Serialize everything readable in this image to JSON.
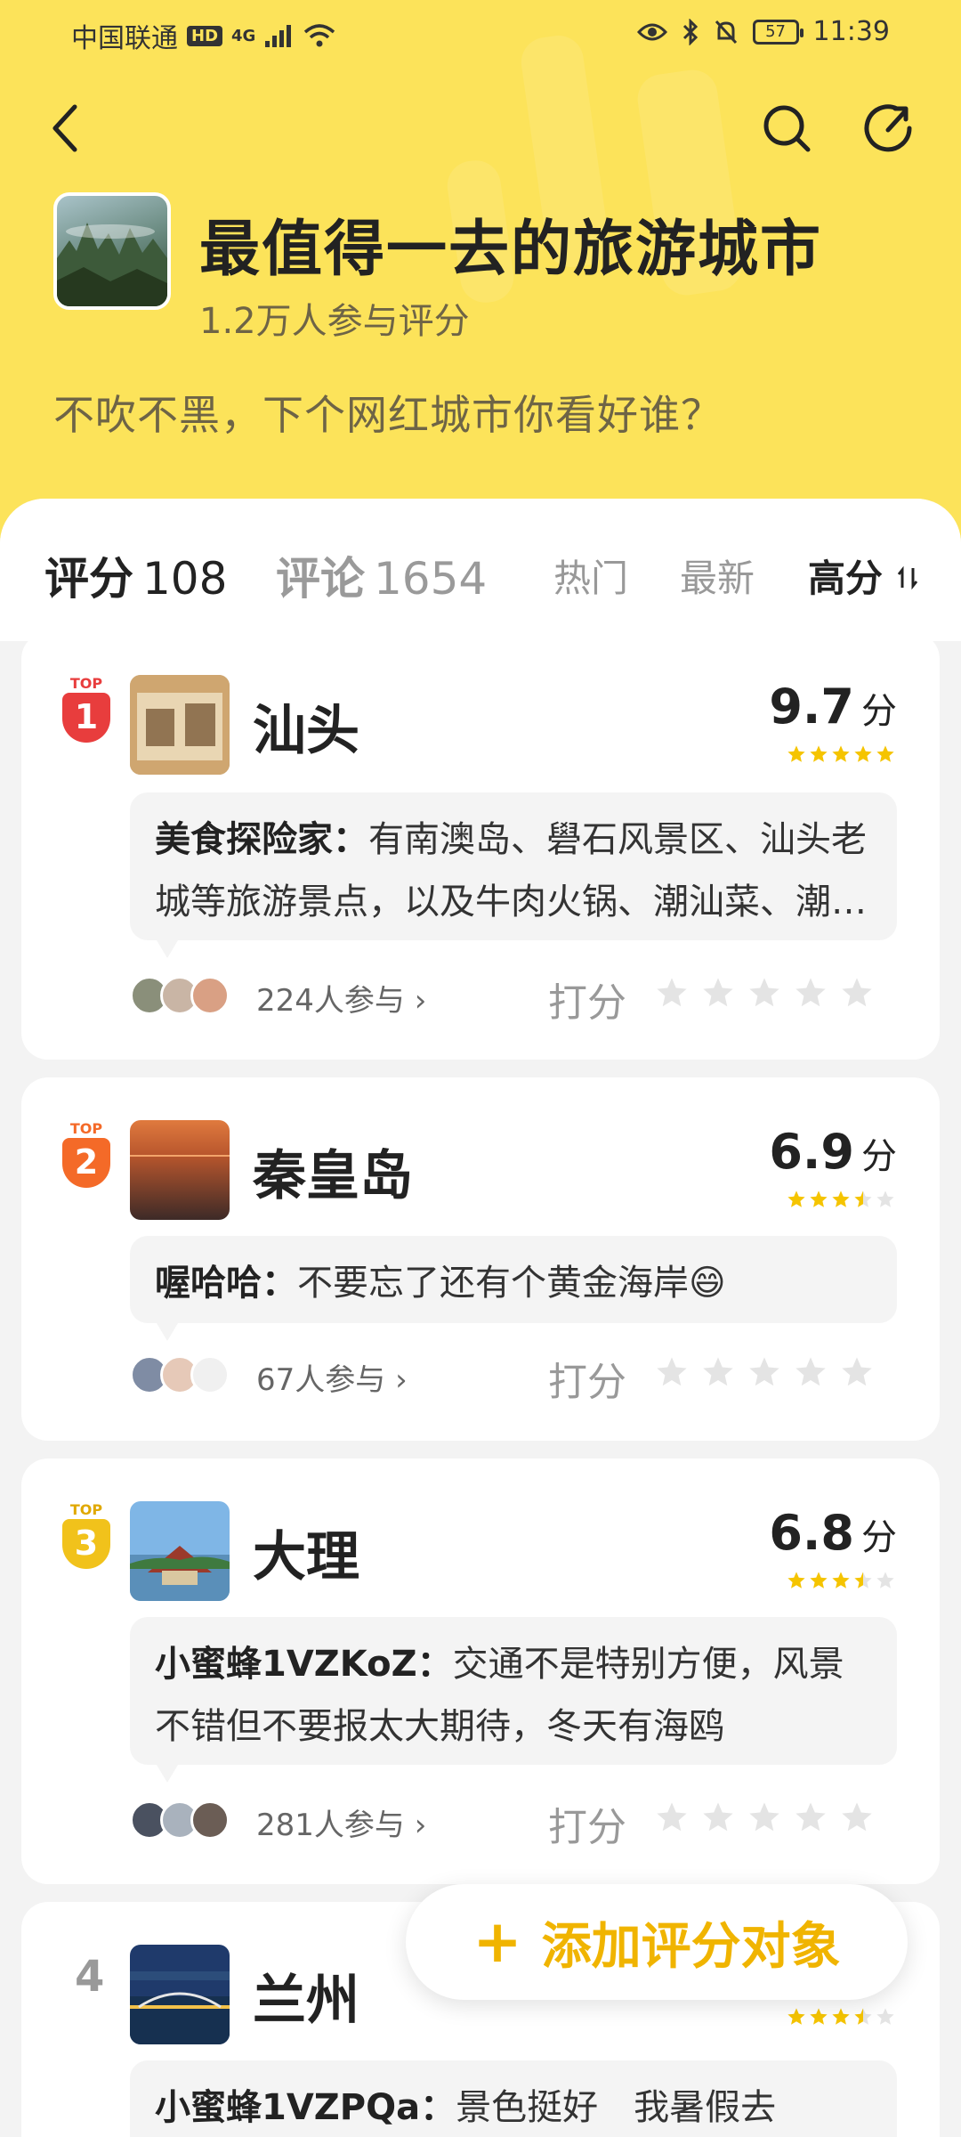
{
  "status_bar": {
    "carrier": "中国联通",
    "hd": "HD",
    "network": "4G",
    "battery": "57",
    "time": "11:39"
  },
  "hero": {
    "title": "最值得一去的旅游城市",
    "participants": "1.2万人参与评分",
    "description": "不吹不黑，下个网红城市你看好谁？"
  },
  "tabs": [
    {
      "label": "评分",
      "count": "108"
    },
    {
      "label": "评论",
      "count": "1654"
    }
  ],
  "sort": [
    "热门",
    "最新",
    "高分"
  ],
  "items": [
    {
      "rank_top": "TOP",
      "rank": "1",
      "city": "汕头",
      "score": "9.7",
      "score_unit": "分",
      "score_stars": 5,
      "comment_author": "美食探险家：",
      "comment_text": "有南澳岛、礐石风景区、汕头老城等旅游景点，以及牛肉火锅、潮汕菜、潮汕小吃等等",
      "participants": "224人参与",
      "rate_label": "打分",
      "rank_color": "#e83d3d"
    },
    {
      "rank_top": "TOP",
      "rank": "2",
      "city": "秦皇岛",
      "score": "6.9",
      "score_unit": "分",
      "score_stars": 3.5,
      "comment_author": "喔哈哈：",
      "comment_text": "不要忘了还有个黄金海岸",
      "participants": "67人参与",
      "rate_label": "打分",
      "rank_color": "#f46a28"
    },
    {
      "rank_top": "TOP",
      "rank": "3",
      "city": "大理",
      "score": "6.8",
      "score_unit": "分",
      "score_stars": 3.5,
      "comment_author": "小蜜蜂1VZKoZ：",
      "comment_text": "交通不是特别方便，风景不错但不要报太大期待，冬天有海鸥",
      "participants": "281人参与",
      "rate_label": "打分",
      "rank_color": "#f1c21b"
    },
    {
      "rank": "4",
      "city": "兰州",
      "score_stars": 3.5,
      "comment_author": "小蜜蜂1VZPQa：",
      "comment_text": "景色挺好　我暑假去"
    }
  ],
  "fab": {
    "label": "添加评分对象"
  },
  "colors": {
    "header_bg": "#fce35a",
    "accent": "#f0b400",
    "star_on": "#f5c400",
    "star_off": "#e4e4e4"
  }
}
